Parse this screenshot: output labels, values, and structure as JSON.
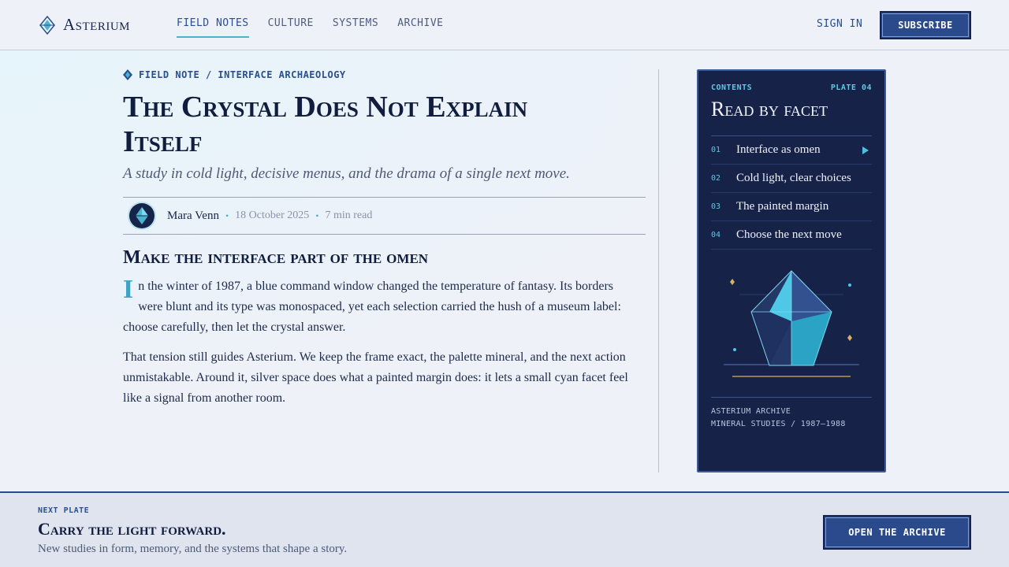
{
  "brand": {
    "name": "Asterium",
    "logo_icon": "crystal-logo-icon"
  },
  "nav": {
    "items": [
      {
        "label": "FIELD NOTES",
        "active": true
      },
      {
        "label": "CULTURE",
        "active": false
      },
      {
        "label": "SYSTEMS",
        "active": false
      },
      {
        "label": "ARCHIVE",
        "active": false
      }
    ],
    "sign_in": "SIGN IN",
    "subscribe": "SUBSCRIBE"
  },
  "article": {
    "eyebrow": "FIELD NOTE / INTERFACE ARCHAEOLOGY",
    "title": "The Crystal Does Not Explain Itself",
    "subtitle": "A study in cold light, decisive menus, and the drama of a single next move.",
    "author": "Mara Venn",
    "date": "18 October 2025",
    "read_time": "7 min read",
    "section_heading": "Make the interface part of the omen",
    "dropcap": "I",
    "para1_rest": "n the winter of 1987, a blue command window changed the temperature of fantasy. Its borders were blunt and its type was monospaced, yet each selection carried the hush of a museum label: choose carefully, then let the crystal answer.",
    "para2": "That tension still guides Asterium. We keep the frame exact, the palette mineral, and the next action unmistakable. Around it, silver space does what a painted margin does: it lets a small cyan facet feel like a signal from another room."
  },
  "contents": {
    "label": "CONTENTS",
    "plate": "PLATE 04",
    "title": "Read by facet",
    "items": [
      {
        "num": "01",
        "label": "Interface as omen",
        "current": true
      },
      {
        "num": "02",
        "label": "Cold light, clear choices",
        "current": false
      },
      {
        "num": "03",
        "label": "The painted margin",
        "current": false
      },
      {
        "num": "04",
        "label": "Choose the next move",
        "current": false
      }
    ],
    "footer_line1": "ASTERIUM ARCHIVE",
    "footer_line2": "MINERAL STUDIES / 1987–1988"
  },
  "footer": {
    "label": "NEXT PLATE",
    "title": "Carry the light forward.",
    "subtitle": "New studies in form, memory, and the systems that shape a story.",
    "button": "OPEN THE ARCHIVE"
  },
  "colors": {
    "accent": "#4bb3cf",
    "brand": "#2b4a8b",
    "panel": "#162248",
    "background": "#eef1f8"
  }
}
